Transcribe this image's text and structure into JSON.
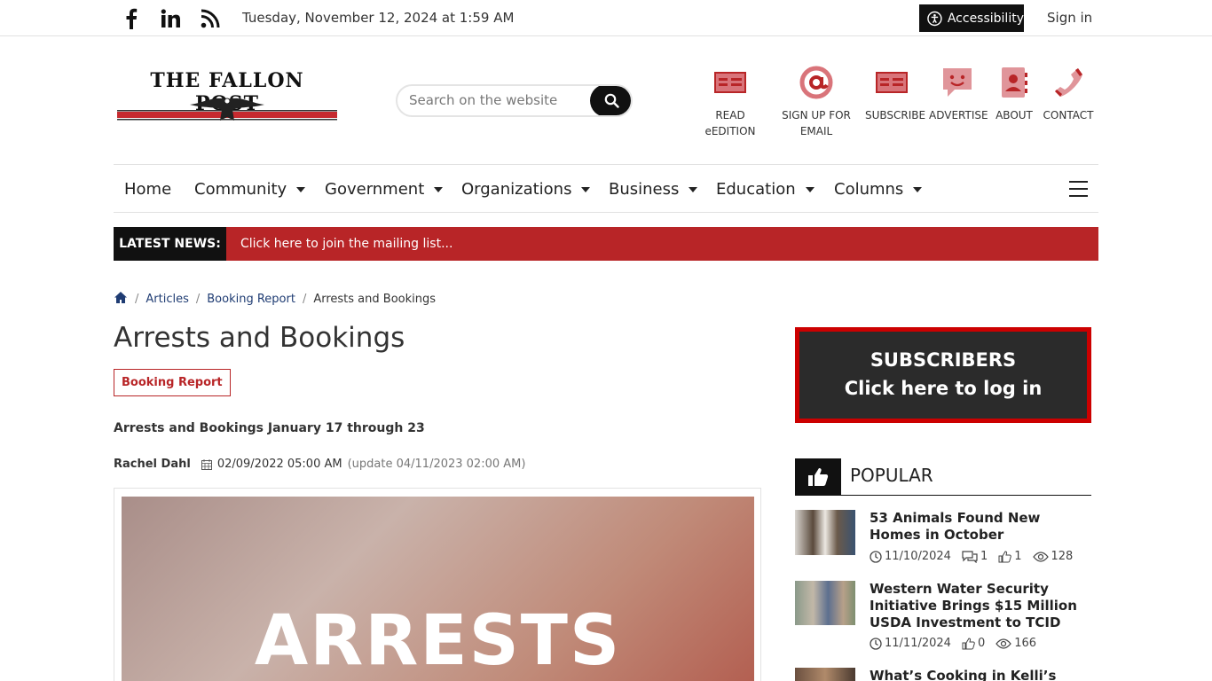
{
  "topbar": {
    "date": "Tuesday, November 12, 2024 at 1:59 AM",
    "accessibility": "Accessibility",
    "signin": "Sign in",
    "social": [
      "facebook-icon",
      "linkedin-icon",
      "rss-icon"
    ]
  },
  "header": {
    "logo_text": "THE FALLON POST",
    "search_placeholder": "Search on the website",
    "icons": [
      {
        "label1": "READ",
        "label2": "eEDITION",
        "icon": "newspaper-icon"
      },
      {
        "label1": "SIGN UP FOR",
        "label2": "EMAIL",
        "icon": "at-icon"
      },
      {
        "label1": "SUBSCRIBE",
        "label2": "",
        "icon": "newspaper-icon"
      },
      {
        "label1": "ADVERTISE",
        "label2": "",
        "icon": "smile-chat-icon"
      },
      {
        "label1": "ABOUT",
        "label2": "",
        "icon": "contact-book-icon"
      },
      {
        "label1": "CONTACT",
        "label2": "",
        "icon": "phone-icon"
      }
    ]
  },
  "nav": {
    "items": [
      "Home",
      "Community",
      "Government",
      "Organizations",
      "Business",
      "Education",
      "Columns"
    ]
  },
  "latest": {
    "label": "LATEST NEWS:",
    "text": "Click here to join the mailing list..."
  },
  "breadcrumb": [
    "Articles",
    "Booking Report",
    "Arrests and Bookings"
  ],
  "article": {
    "title": "Arrests and Bookings",
    "tag": "Booking Report",
    "subhead": "Arrests and Bookings January 17 through 23",
    "author": "Rachel Dahl",
    "date": "02/09/2022 05:00 AM",
    "updated": "(update 04/11/2023 02:00 AM)",
    "hero_text": "ARRESTS"
  },
  "sidebar": {
    "sub_line1": "SUBSCRIBERS",
    "sub_line2": "Click here to log in",
    "popular_title": "POPULAR",
    "popular": [
      {
        "title": "53 Animals Found New Homes in October",
        "date": "11/10/2024",
        "comments": "1",
        "likes": "1",
        "views": "128"
      },
      {
        "title": "Western Water Security Initiative Brings $15 Million USDA Investment to TCID",
        "date": "11/11/2024",
        "comments": "",
        "likes": "0",
        "views": "166"
      },
      {
        "title": "What’s Cooking in Kelli’s Kitchen",
        "date": "",
        "comments": "",
        "likes": "",
        "views": ""
      }
    ]
  },
  "colors": {
    "accent": "#b82527",
    "dark": "#111111",
    "link": "#1f3c73",
    "icon_pink": "#d9747a"
  }
}
